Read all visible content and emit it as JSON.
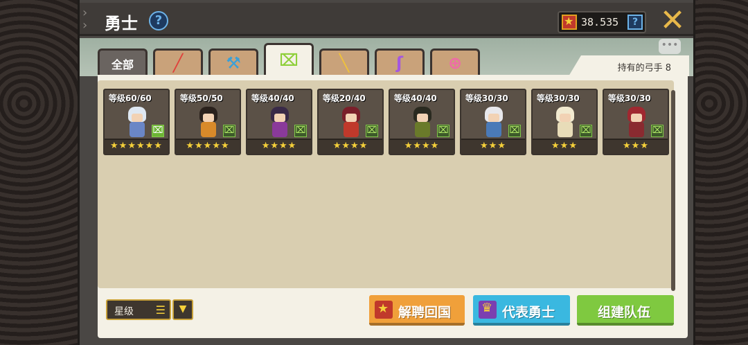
{
  "header": {
    "title": "勇士",
    "help_icon": "?",
    "currency_value": "38.535",
    "currency_help_icon": "?",
    "close_icon": "✕"
  },
  "tabs": [
    {
      "key": "all",
      "label": "全部",
      "icon": "",
      "color": "#6a6460",
      "active": false
    },
    {
      "key": "warrior",
      "label": "",
      "icon": "sword-icon",
      "glyph": "╱",
      "color": "#e0413b",
      "active": false
    },
    {
      "key": "tank",
      "label": "",
      "icon": "hammer-icon",
      "glyph": "⚒",
      "color": "#3aa0d8",
      "active": false
    },
    {
      "key": "archer",
      "label": "",
      "icon": "bow-icon",
      "glyph": "⌧",
      "color": "#8ecf3a",
      "active": true
    },
    {
      "key": "gunner",
      "label": "",
      "icon": "gun-icon",
      "glyph": "╲",
      "color": "#f0c23a",
      "active": false
    },
    {
      "key": "mage",
      "label": "",
      "icon": "staff-icon",
      "glyph": "ʃ",
      "color": "#a457e0",
      "active": false
    },
    {
      "key": "healer",
      "label": "",
      "icon": "ring-icon",
      "glyph": "⊕",
      "color": "#f06aa8",
      "active": false
    }
  ],
  "archer_count_label": "持有的弓手 8",
  "heroes": [
    {
      "level": "等级60/60",
      "stars": "★★★★★★",
      "hair": "#dfe8f2",
      "outfit": "#6a86c6",
      "class_bright": true
    },
    {
      "level": "等级50/50",
      "stars": "★★★★★",
      "hair": "#2a211c",
      "outfit": "#d88a2a",
      "class_bright": false
    },
    {
      "level": "等级40/40",
      "stars": "★★★★",
      "hair": "#3a2a48",
      "outfit": "#8a3a9a",
      "class_bright": false
    },
    {
      "level": "等级20/40",
      "stars": "★★★★",
      "hair": "#7a1f2a",
      "outfit": "#c0392b",
      "class_bright": false
    },
    {
      "level": "等级40/40",
      "stars": "★★★★",
      "hair": "#2a2a20",
      "outfit": "#6a7a2a",
      "class_bright": false
    },
    {
      "level": "等级30/30",
      "stars": "★★★",
      "hair": "#e8e8ec",
      "outfit": "#4a7ab8",
      "class_bright": false
    },
    {
      "level": "等级30/30",
      "stars": "★★★",
      "hair": "#f2ead0",
      "outfit": "#e8dcb8",
      "class_bright": false
    },
    {
      "level": "等级30/30",
      "stars": "★★★",
      "hair": "#a02830",
      "outfit": "#8a2a30",
      "class_bright": false
    }
  ],
  "sort": {
    "label": "星级",
    "list_icon": "☰",
    "order_icon": "▼"
  },
  "buttons": {
    "dismiss": "解聘回国",
    "represent": "代表勇士",
    "team": "组建队伍"
  },
  "bubble_icon": "•••"
}
